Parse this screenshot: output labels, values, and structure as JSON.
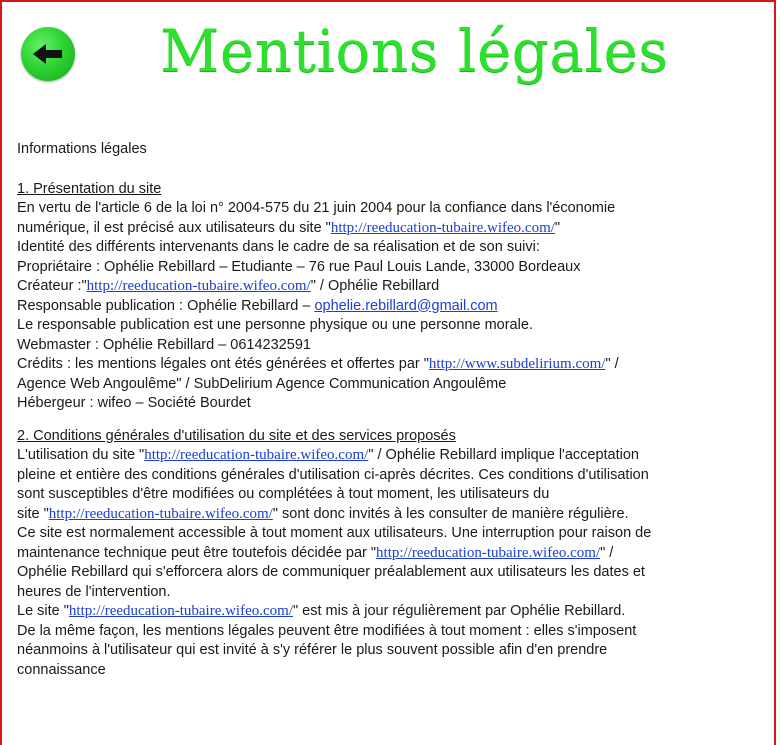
{
  "page": {
    "title": "Mentions légales"
  },
  "back_button": {
    "icon": "arrow-left-icon"
  },
  "intro_heading": "Informations légales",
  "section1": {
    "title": "1. Présentation du site",
    "l1": "En vertu de l'article 6 de la loi n° 2004-575 du 21 juin 2004 pour la confiance dans l'économie",
    "l2a": "numérique, il est précisé aux utilisateurs du site \"",
    "l2_link": "http://reeducation-tubaire.wifeo.com/",
    "l2b": "\"",
    "l3": "Identité des différents intervenants dans le cadre de sa réalisation et de son suivi:",
    "l4": "Propriétaire : Ophélie Rebillard – Etudiante – 76 rue Paul Louis Lande, 33000 Bordeaux",
    "l5a": "Créateur :\"",
    "l5_link": "http://reeducation-tubaire.wifeo.com/",
    "l5b": "\" / Ophélie Rebillard",
    "l6a": "Responsable publication : Ophélie Rebillard – ",
    "l6_link": "ophelie.rebillard@gmail.com",
    "l7": "Le responsable publication est une personne physique ou une personne morale.",
    "l8": "Webmaster : Ophélie Rebillard – 0614232591",
    "l9a": "Crédits : les mentions légales ont étés générées et offertes par \"",
    "l9_link": "http://www.subdelirium.com/",
    "l9b": "\" /",
    "l10": "Agence Web Angoulême\" / SubDelirium Agence Communication Angoulême",
    "l11": "Hébergeur : wifeo – Société Bourdet"
  },
  "section2": {
    "title": "2. Conditions générales d'utilisation du site et des services proposés",
    "l1a": "L'utilisation du site \"",
    "l1_link": "http://reeducation-tubaire.wifeo.com/",
    "l1b": "\" / Ophélie Rebillard implique l'acceptation",
    "l2": "pleine et entière des conditions générales d'utilisation ci-après décrites. Ces conditions d'utilisation",
    "l3": "sont susceptibles d'être modifiées ou complétées à tout moment, les utilisateurs du",
    "l4a": "site \"",
    "l4_link": "http://reeducation-tubaire.wifeo.com/",
    "l4b": "\" sont donc invités à les consulter de manière régulière.",
    "l5": "Ce site est normalement accessible à tout moment aux utilisateurs. Une interruption pour raison de",
    "l6a": "maintenance technique peut être toutefois décidée par \"",
    "l6_link": "http://reeducation-tubaire.wifeo.com/",
    "l6b": "\" /",
    "l7": "Ophélie Rebillard qui s'efforcera alors de communiquer préalablement aux utilisateurs les dates et",
    "l8": "heures de l'intervention.",
    "l9a": "Le site \"",
    "l9_link": "http://reeducation-tubaire.wifeo.com/",
    "l9b": "\"  est mis à jour régulièrement par Ophélie Rebillard.",
    "l10": "De la même façon, les mentions légales peuvent être modifiées à tout moment : elles s'imposent",
    "l11": "néanmoins à l'utilisateur qui est invité à s'y référer le plus souvent possible afin d'en prendre",
    "l12": "connaissance"
  },
  "colors": {
    "title_green": "#2ee02e",
    "frame_red": "#d9141b",
    "link_blue": "#1c3fd1"
  }
}
